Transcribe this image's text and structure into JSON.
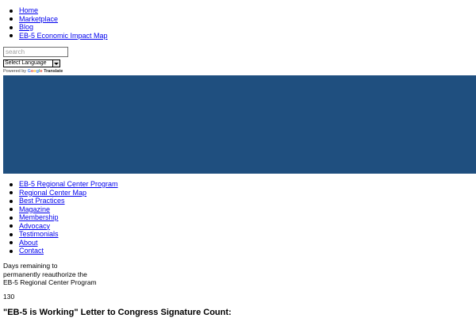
{
  "top_nav": {
    "items": [
      {
        "label": "Home"
      },
      {
        "label": "Marketplace"
      },
      {
        "label": "Blog"
      },
      {
        "label": "EB-5 Economic Impact Map"
      }
    ]
  },
  "search": {
    "placeholder": "search"
  },
  "language": {
    "selected": "Select Language",
    "powered_by": "Powered by",
    "google": [
      "G",
      "o",
      "o",
      "g",
      "l",
      "e"
    ],
    "translate": "Translate"
  },
  "banner": {
    "color": "#1f4f7f"
  },
  "main_nav": {
    "items": [
      {
        "label": "EB-5 Regional Center Program"
      },
      {
        "label": "Regional Center Map"
      },
      {
        "label": "Best Practices"
      },
      {
        "label": "Magazine"
      },
      {
        "label": "Membership"
      },
      {
        "label": "Advocacy"
      },
      {
        "label": "Testimonials"
      },
      {
        "label": "About"
      },
      {
        "label": "Contact"
      }
    ]
  },
  "countdown": {
    "lines": [
      "Days remaining to",
      "permanently reauthorize the",
      "EB-5 Regional Center Program"
    ],
    "value": "130"
  },
  "signature": {
    "heading": "\"EB-5 is Working\" Letter to Congress Signature Count:"
  }
}
